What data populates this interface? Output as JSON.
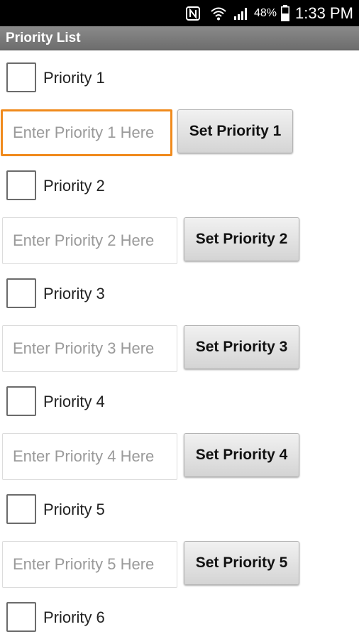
{
  "status_bar": {
    "battery_percent": "48%",
    "time": "1:33 PM",
    "icons": [
      "nfc-icon",
      "wifi-icon",
      "signal-icon",
      "battery-icon"
    ]
  },
  "app": {
    "title": "Priority List"
  },
  "priorities": [
    {
      "checkbox_label": "Priority 1",
      "checked": false,
      "input_placeholder": "Enter Priority 1 Here",
      "input_value": "",
      "button_label": "Set Priority 1",
      "focused": true
    },
    {
      "checkbox_label": "Priority 2",
      "checked": false,
      "input_placeholder": "Enter Priority 2 Here",
      "input_value": "",
      "button_label": "Set Priority 2",
      "focused": false
    },
    {
      "checkbox_label": "Priority 3",
      "checked": false,
      "input_placeholder": "Enter Priority 3 Here",
      "input_value": "",
      "button_label": "Set Priority 3",
      "focused": false
    },
    {
      "checkbox_label": "Priority 4",
      "checked": false,
      "input_placeholder": "Enter Priority 4 Here",
      "input_value": "",
      "button_label": "Set Priority 4",
      "focused": false
    },
    {
      "checkbox_label": "Priority 5",
      "checked": false,
      "input_placeholder": "Enter Priority 5 Here",
      "input_value": "",
      "button_label": "Set Priority 5",
      "focused": false
    },
    {
      "checkbox_label": "Priority 6",
      "checked": false
    }
  ],
  "colors": {
    "focus_border": "#f08a1c",
    "title_bar": "#7a7a7a",
    "status_bar": "#000000"
  }
}
